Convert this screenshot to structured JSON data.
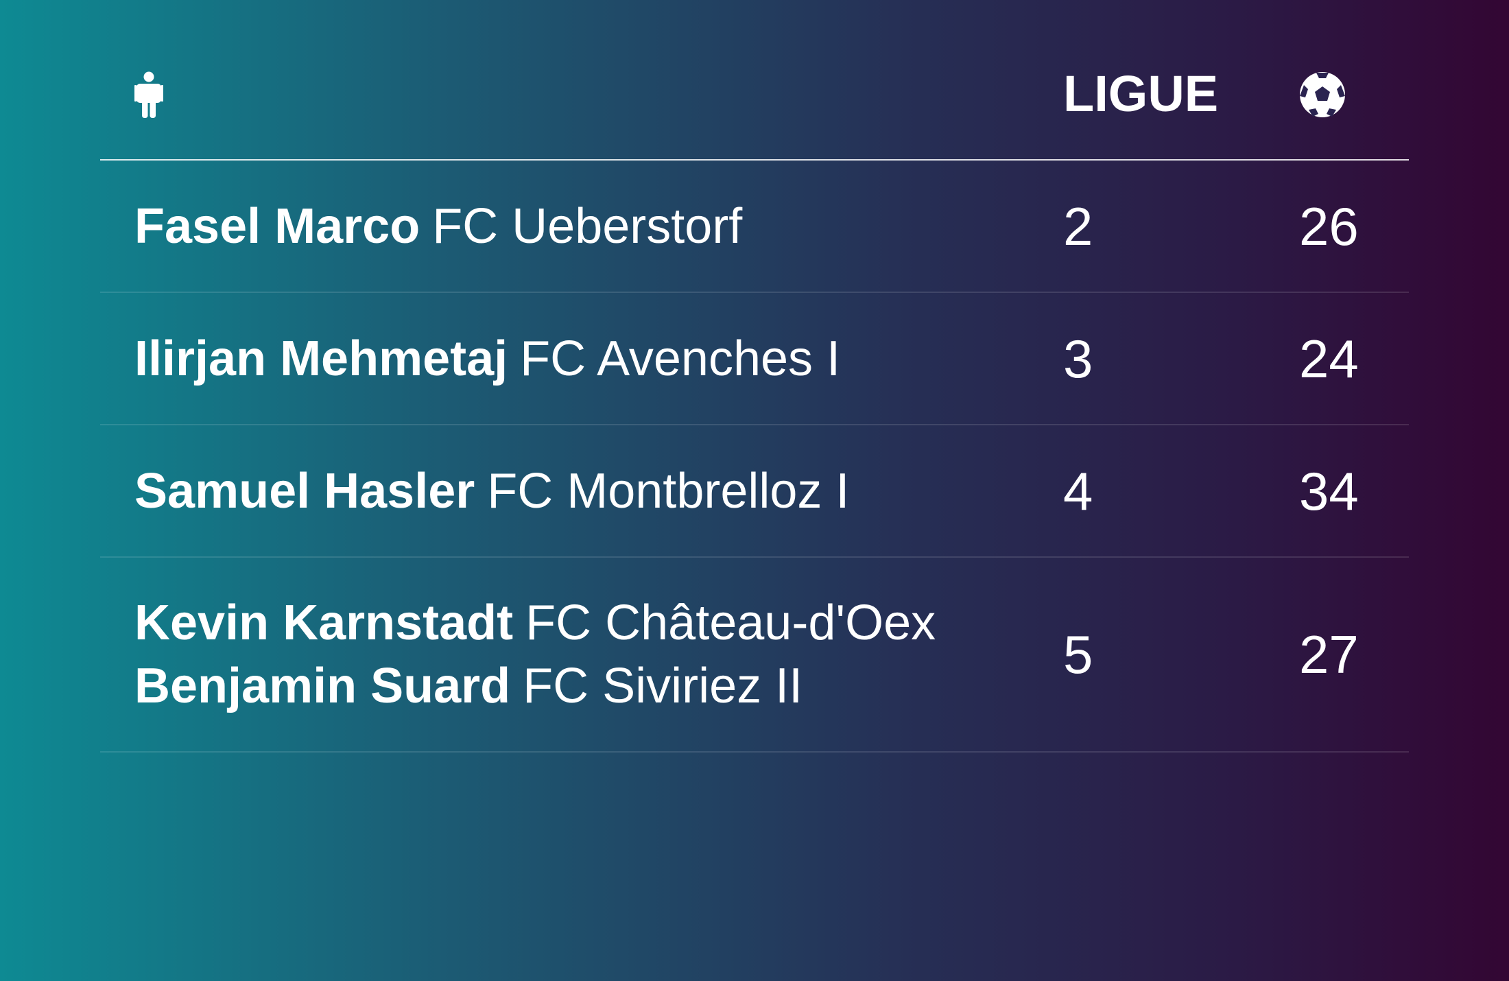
{
  "header": {
    "player_icon": "person-icon",
    "ligue_label": "LIGUE",
    "goals_icon": "soccer-ball-icon"
  },
  "rows": [
    {
      "players": [
        {
          "name": "Fasel Marco",
          "club": "FC Ueberstorf"
        }
      ],
      "ligue": "2",
      "goals": "26"
    },
    {
      "players": [
        {
          "name": "Ilirjan Mehmetaj",
          "club": "FC Avenches I"
        }
      ],
      "ligue": "3",
      "goals": "24"
    },
    {
      "players": [
        {
          "name": "Samuel Hasler",
          "club": "FC Montbrelloz I"
        }
      ],
      "ligue": "4",
      "goals": "34"
    },
    {
      "players": [
        {
          "name": "Kevin Karnstadt",
          "club": "FC Château-d'Oex"
        },
        {
          "name": "Benjamin Suard",
          "club": "FC Siviriez II"
        }
      ],
      "ligue": "5",
      "goals": "27"
    }
  ],
  "colors": {
    "gradient_left": "#0e8a93",
    "gradient_right": "#330633",
    "text": "#ffffff"
  }
}
